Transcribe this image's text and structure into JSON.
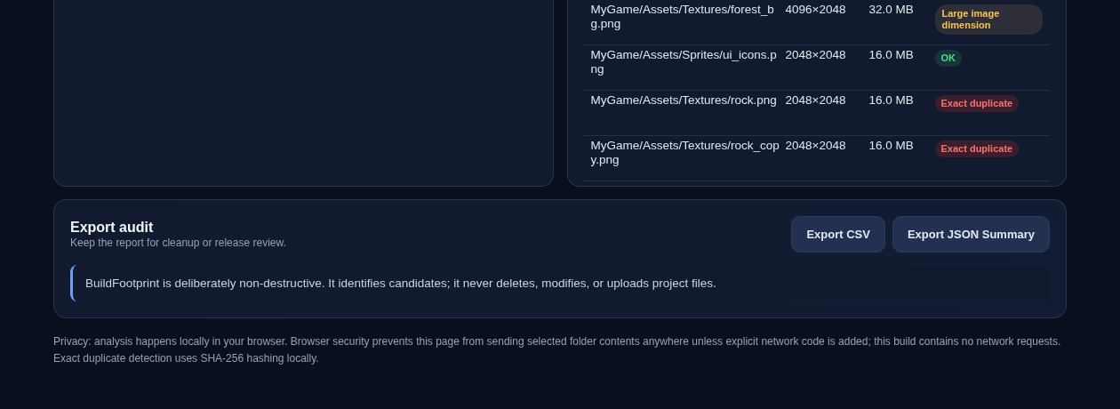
{
  "assets": {
    "rows": [
      {
        "path": "MyGame/Assets/Textures/forest_bg.png",
        "dimensions": "4096×2048",
        "size": "32.0 MB",
        "status": {
          "kind": "warning",
          "label": "Large image dimension"
        }
      },
      {
        "path": "MyGame/Assets/Sprites/ui_icons.png",
        "dimensions": "2048×2048",
        "size": "16.0 MB",
        "status": {
          "kind": "ok",
          "label": "OK"
        }
      },
      {
        "path": "MyGame/Assets/Textures/rock.png",
        "dimensions": "2048×2048",
        "size": "16.0 MB",
        "status": {
          "kind": "duplicate",
          "label": "Exact duplicate"
        }
      },
      {
        "path": "MyGame/Assets/Textures/rock_copy.png",
        "dimensions": "2048×2048",
        "size": "16.0 MB",
        "status": {
          "kind": "duplicate",
          "label": "Exact duplicate"
        }
      }
    ]
  },
  "export": {
    "title": "Export audit",
    "subtitle": "Keep the report for cleanup or release review.",
    "buttons": [
      "Export CSV",
      "Export JSON Summary"
    ],
    "notice": "BuildFootprint is deliberately non-destructive. It identifies candidates; it never deletes, modifies, or uploads project files."
  },
  "footer": "Privacy: analysis happens locally in your browser. Browser security prevents this page from sending selected folder contents anywhere unless explicit network code is added; this build contains no network requests. Exact duplicate detection uses SHA-256 hashing locally."
}
